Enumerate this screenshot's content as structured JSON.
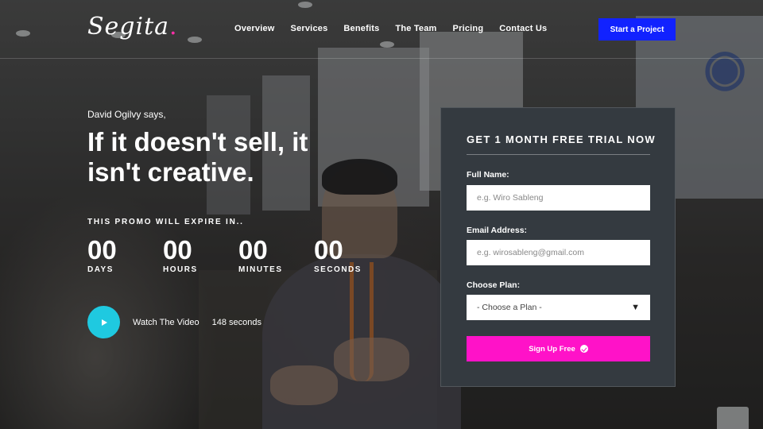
{
  "header": {
    "logo_text": "Segita",
    "logo_dot": ".",
    "nav": [
      {
        "label": "Overview"
      },
      {
        "label": "Services"
      },
      {
        "label": "Benefits"
      },
      {
        "label": "The Team"
      },
      {
        "label": "Pricing"
      },
      {
        "label": "Contact Us"
      }
    ],
    "cta_label": "Start a Project"
  },
  "hero": {
    "quote_by": "David Ogilvy says,",
    "headline": "If it doesn't sell, it isn't creative.",
    "promo_label": "THIS PROMO WILL EXPIRE IN..",
    "countdown": [
      {
        "value": "00",
        "label": "DAYS"
      },
      {
        "value": "00",
        "label": "HOURS"
      },
      {
        "value": "00",
        "label": "MINUTES"
      },
      {
        "value": "00",
        "label": "SECONDS"
      }
    ],
    "video": {
      "label": "Watch The Video",
      "duration": "148 seconds"
    }
  },
  "form": {
    "title": "GET 1 MONTH FREE TRIAL NOW",
    "name_label": "Full Name:",
    "name_placeholder": "e.g. Wiro Sableng",
    "email_label": "Email Address:",
    "email_placeholder": "e.g. wirosableng@gmail.com",
    "plan_label": "Choose Plan:",
    "plan_selected": "- Choose a Plan -",
    "submit_label": "Sign Up Free"
  },
  "colors": {
    "accent_blue": "#1122ff",
    "accent_magenta": "#ff12c8",
    "accent_cyan": "#1fc9e0",
    "card_bg": "#343a40"
  }
}
